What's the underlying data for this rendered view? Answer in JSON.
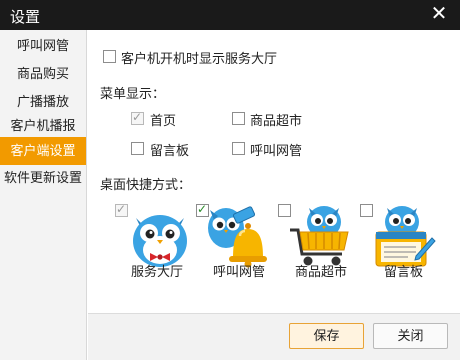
{
  "window": {
    "title": "设置"
  },
  "sidebar": {
    "items": [
      {
        "label": "呼叫网管"
      },
      {
        "label": "商品购买"
      },
      {
        "label": "广播播放"
      },
      {
        "label": "客户机播报"
      },
      {
        "label": "客户端设置",
        "active": true
      },
      {
        "label": "软件更新设置"
      }
    ]
  },
  "settings": {
    "startup_option": {
      "label": "客户机开机时显示服务大厅",
      "checked": false
    },
    "menu_section_label": "菜单显示：",
    "menu_items": [
      {
        "label": "首页",
        "checked": true,
        "disabled": true
      },
      {
        "label": "商品超市",
        "checked": false
      },
      {
        "label": "留言板",
        "checked": false
      },
      {
        "label": "呼叫网管",
        "checked": false
      }
    ],
    "desktop_section_label": "桌面快捷方式：",
    "shortcuts": [
      {
        "label": "服务大厅",
        "checked": true,
        "disabled": true,
        "icon": "owl-bowtie-icon"
      },
      {
        "label": "呼叫网管",
        "checked": true,
        "disabled": false,
        "icon": "owl-bell-icon"
      },
      {
        "label": "商品超市",
        "checked": false,
        "disabled": false,
        "icon": "owl-shopping-cart-icon"
      },
      {
        "label": "留言板",
        "checked": false,
        "disabled": false,
        "icon": "owl-notepad-icon"
      }
    ]
  },
  "footer": {
    "save_label": "保存",
    "close_label": "关闭"
  },
  "colors": {
    "accent": "#f29a00",
    "titlebar": "#1a1a1a",
    "owl_blue": "#3aa3e3"
  }
}
